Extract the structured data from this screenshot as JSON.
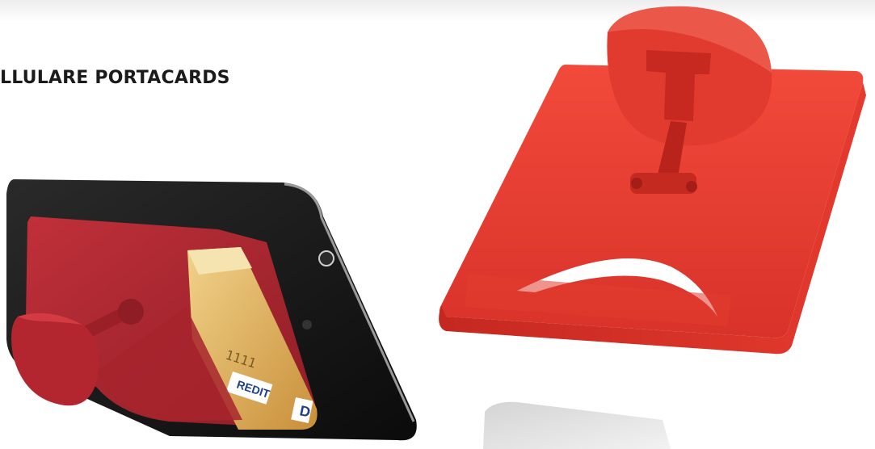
{
  "page": {
    "title": "LLULARE PORTACARDS"
  },
  "product_photo": {
    "subject": "red phone stand card holder",
    "card_text_credit": "REDIT",
    "card_text_id": "D",
    "card_text_digits": "1111",
    "colors": {
      "accent": "#e8392e",
      "dark_red": "#a8232a",
      "phone": "#151515",
      "card_gold": "#e2b55a"
    }
  }
}
